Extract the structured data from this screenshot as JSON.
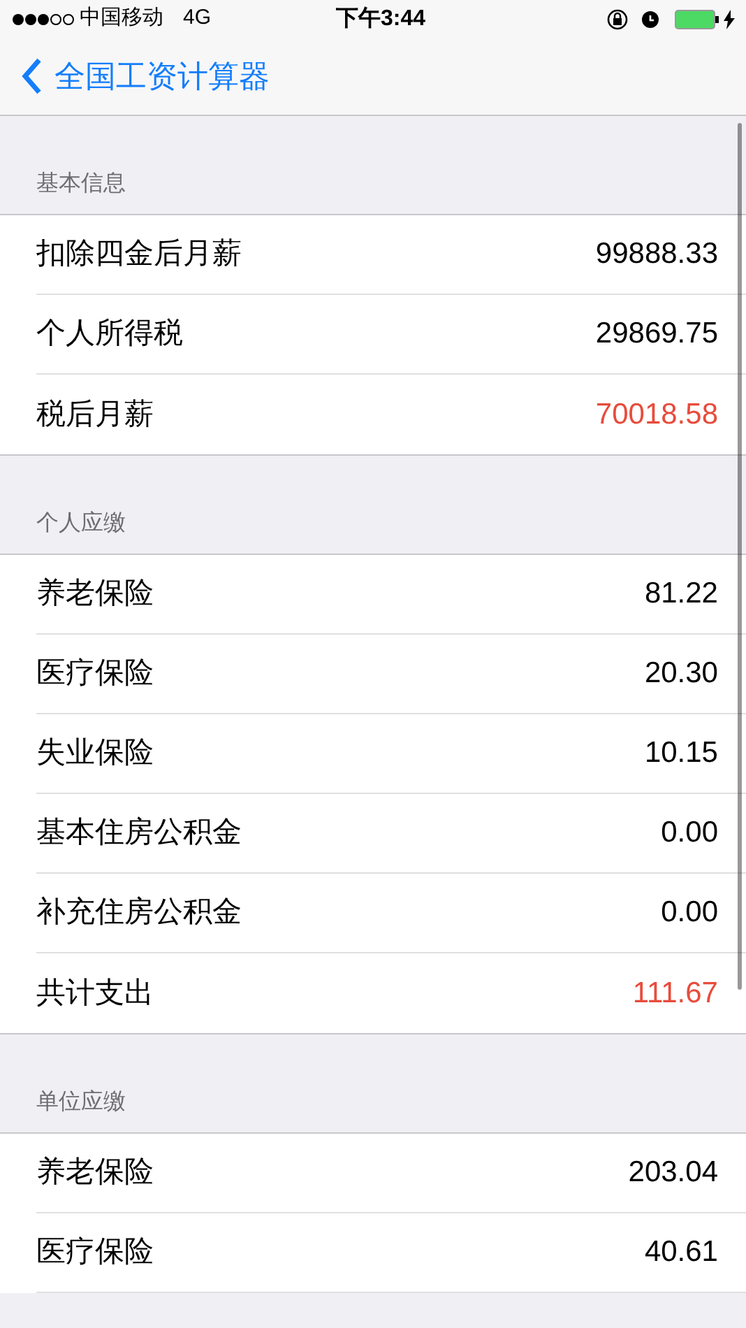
{
  "status_bar": {
    "carrier": "中国移动",
    "network": "4G",
    "time": "下午3:44"
  },
  "nav": {
    "back_title": "全国工资计算器"
  },
  "sections": [
    {
      "header": "基本信息",
      "rows": [
        {
          "label": "扣除四金后月薪",
          "value": "99888.33",
          "highlight": false
        },
        {
          "label": "个人所得税",
          "value": "29869.75",
          "highlight": false
        },
        {
          "label": "税后月薪",
          "value": "70018.58",
          "highlight": true
        }
      ]
    },
    {
      "header": "个人应缴",
      "rows": [
        {
          "label": "养老保险",
          "value": "81.22",
          "highlight": false
        },
        {
          "label": "医疗保险",
          "value": "20.30",
          "highlight": false
        },
        {
          "label": "失业保险",
          "value": "10.15",
          "highlight": false
        },
        {
          "label": "基本住房公积金",
          "value": "0.00",
          "highlight": false
        },
        {
          "label": "补充住房公积金",
          "value": "0.00",
          "highlight": false
        },
        {
          "label": "共计支出",
          "value": "111.67",
          "highlight": true
        }
      ]
    },
    {
      "header": "单位应缴",
      "rows": [
        {
          "label": "养老保险",
          "value": "203.04",
          "highlight": false
        },
        {
          "label": "医疗保险",
          "value": "40.61",
          "highlight": false
        }
      ]
    }
  ]
}
